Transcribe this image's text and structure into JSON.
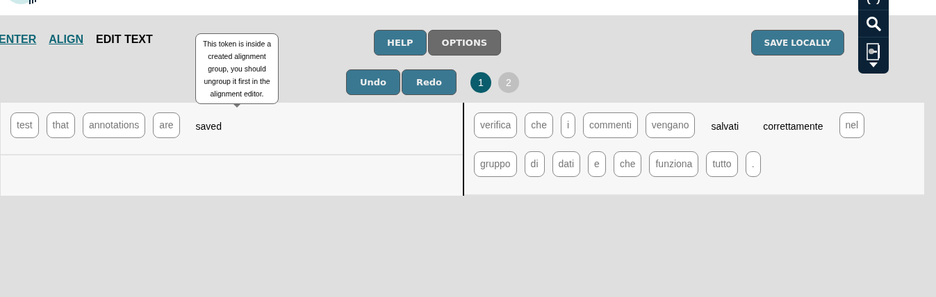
{
  "nav_tabs": [
    {
      "label": "ENTER",
      "selected": false
    },
    {
      "label": "ALIGN",
      "selected": false
    },
    {
      "label": "EDIT TEXT",
      "selected": true
    }
  ],
  "toolbar_buttons": [
    {
      "label": "HELP",
      "kind": "primary"
    },
    {
      "label": "OPTIONS",
      "kind": "secondary"
    }
  ],
  "save_button": {
    "label": "SAVE LOCALLY"
  },
  "history_buttons": [
    {
      "label": "Undo"
    },
    {
      "label": "Redo"
    }
  ],
  "pages": [
    {
      "label": "1",
      "selected": true
    },
    {
      "label": "2",
      "selected": false
    }
  ],
  "tooltip": {
    "text": "This token is inside a created alignment group, you should ungroup it first in the alignment editor."
  },
  "source_rows": [
    {
      "tokens": [
        {
          "text": "test",
          "kind": "boxed"
        },
        {
          "text": "that",
          "kind": "boxed"
        },
        {
          "text": "annotations",
          "kind": "boxed"
        },
        {
          "text": "are",
          "kind": "boxed"
        },
        {
          "text": "saved",
          "kind": "plain"
        }
      ]
    },
    {
      "tokens": []
    }
  ],
  "target_rows": [
    {
      "tokens": [
        {
          "text": "verifica",
          "kind": "boxed"
        },
        {
          "text": "che",
          "kind": "boxed"
        },
        {
          "text": "i",
          "kind": "boxed"
        },
        {
          "text": "commenti",
          "kind": "boxed"
        },
        {
          "text": "vengano",
          "kind": "boxed"
        },
        {
          "text": "salvati",
          "kind": "plain"
        },
        {
          "text": "correttamente",
          "kind": "plain"
        },
        {
          "text": "nel",
          "kind": "boxed"
        },
        {
          "text": "gruppo",
          "kind": "boxed"
        },
        {
          "text": "di",
          "kind": "boxed"
        },
        {
          "text": "dati",
          "kind": "boxed"
        },
        {
          "text": "e",
          "kind": "boxed"
        },
        {
          "text": "che",
          "kind": "boxed"
        },
        {
          "text": "funziona",
          "kind": "boxed"
        },
        {
          "text": "tutto",
          "kind": "boxed"
        },
        {
          "text": ".",
          "kind": "boxed"
        }
      ]
    }
  ]
}
